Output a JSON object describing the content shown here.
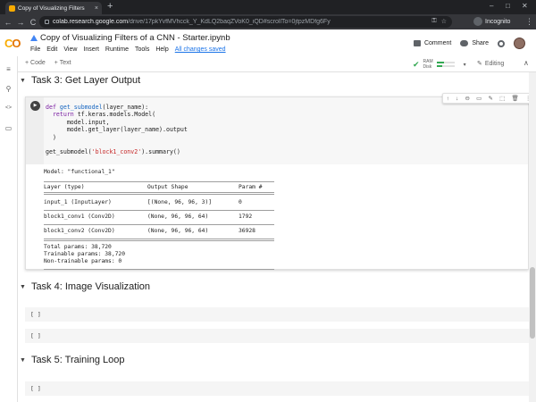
{
  "browser": {
    "tab_title": "Copy of Visualizing Filters",
    "tab_close": "×",
    "new_tab": "+",
    "win_min": "–",
    "win_max": "□",
    "win_close": "✕",
    "url_host": "colab.research.google.com",
    "url_path": "/drive/17pkYvfMVhcck_Y_KdLQ2baqZVoK0_iQD#scrollTo=0jtpzMDfg6Fy",
    "back": "←",
    "forward": "→",
    "reload": "C",
    "incognito_label": "Incognito",
    "kebab": "⋮"
  },
  "colab": {
    "logo_a": "C",
    "logo_b": "O",
    "doc_title": "Copy of Visualizing Filters of a CNN - Starter.ipynb",
    "star": "☆",
    "menu": [
      "File",
      "Edit",
      "View",
      "Insert",
      "Runtime",
      "Tools",
      "Help"
    ],
    "saved_status": "All changes saved",
    "comment_label": "Comment",
    "share_label": "Share"
  },
  "nb_toolbar": {
    "add_code": "+ Code",
    "add_text": "+ Text",
    "ram_label": "RAM",
    "disk_label": "Disk",
    "ram_usage": 0.4,
    "disk_usage": 0.3,
    "editing_label": "Editing",
    "dropdown": "▾",
    "pencil": "✎",
    "collapse": "∧"
  },
  "rail": {
    "icons": [
      "≡",
      "⚲",
      "<>",
      "▭"
    ]
  },
  "sections": {
    "task3": "Task 3: Get Layer Output",
    "task4": "Task 4: Image Visualization",
    "task5": "Task 5: Training Loop",
    "triangle": "▼"
  },
  "cell": {
    "run": "▶",
    "tools": [
      "↑",
      "↓",
      "⊖",
      "▭",
      "✎",
      "⬚",
      "🗑",
      "⋮"
    ]
  },
  "output": {
    "model_line": "Model: \"functional_1\"",
    "headers": [
      "Layer (type)",
      "Output Shape",
      "Param #"
    ],
    "rows": [
      [
        "input_1 (InputLayer)",
        "[(None, 96, 96, 3)]",
        "0"
      ],
      [
        "block1_conv1 (Conv2D)",
        "(None, 96, 96, 64)",
        "1792"
      ],
      [
        "block1_conv2 (Conv2D)",
        "(None, 96, 96, 64)",
        "36928"
      ]
    ],
    "total": "Total params: 38,720",
    "trainable": "Trainable params: 38,720",
    "non_trainable": "Non-trainable params: 0"
  },
  "empty_cells": {
    "placeholder": "[ ]"
  }
}
